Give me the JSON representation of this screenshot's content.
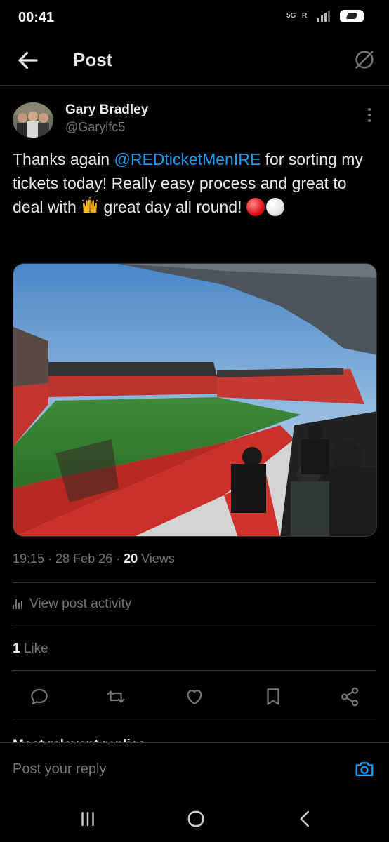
{
  "status_bar": {
    "time": "00:41",
    "network": "5G",
    "roaming": "R"
  },
  "header": {
    "title": "Post",
    "back_icon": "arrow-left-icon",
    "grok_icon": "grok-icon"
  },
  "post": {
    "author_name": "Gary Bradley",
    "author_handle": "@Garylfc5",
    "text_parts": {
      "pre": "Thanks again ",
      "mention": "@REDticketMenIRE",
      "post": " for sorting my tickets today! Really easy process and great to deal with ",
      "end": " great day all round! "
    },
    "emojis": [
      "raising-hands-icon",
      "red-circle-icon",
      "white-circle-icon"
    ],
    "image_description_icon": "stadium-photo",
    "time": "19:15",
    "sep1": " · ",
    "date": "28 Feb 26",
    "sep2": " · ",
    "views_count": "20",
    "views_label": " Views",
    "activity_label": "View post activity",
    "likes_count": "1",
    "likes_label": " Like"
  },
  "actions": [
    "reply-icon",
    "repost-icon",
    "like-icon",
    "bookmark-icon",
    "share-icon"
  ],
  "replies_header": "Most relevant replies",
  "reply_bar": {
    "placeholder": "Post your reply",
    "camera_icon": "camera-icon"
  },
  "nav_bar": [
    "recents-icon",
    "home-icon",
    "back-icon"
  ],
  "colors": {
    "background": "#000000",
    "text": "#e7e9ea",
    "secondary": "#71767b",
    "accent": "#1d9bf0",
    "divider": "#2f3336"
  }
}
